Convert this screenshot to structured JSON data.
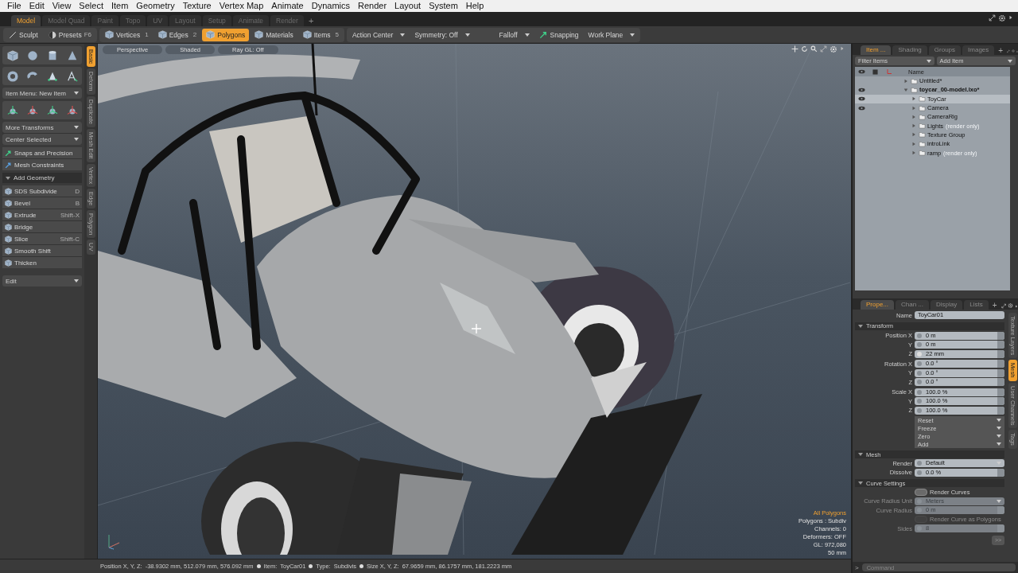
{
  "menu": [
    "File",
    "Edit",
    "View",
    "Select",
    "Item",
    "Geometry",
    "Texture",
    "Vertex Map",
    "Animate",
    "Dynamics",
    "Render",
    "Layout",
    "System",
    "Help"
  ],
  "layout_tabs": [
    {
      "label": "Model",
      "selected": true
    },
    {
      "label": "Model Quad",
      "selected": false
    },
    {
      "label": "Paint",
      "selected": false
    },
    {
      "label": "Topo",
      "selected": false
    },
    {
      "label": "UV",
      "selected": false
    },
    {
      "label": "Layout",
      "selected": false
    },
    {
      "label": "Setup",
      "selected": false
    },
    {
      "label": "Animate",
      "selected": false
    },
    {
      "label": "Render",
      "selected": false
    }
  ],
  "layout_add": "+",
  "toolbar": {
    "left": [
      {
        "label": "Sculpt"
      },
      {
        "label": "Presets",
        "shortcut": "F6"
      }
    ],
    "modes": [
      {
        "label": "Vertices",
        "shortcut": "1",
        "selected": false
      },
      {
        "label": "Edges",
        "shortcut": "2",
        "selected": false
      },
      {
        "label": "Polygons",
        "selected": true
      },
      {
        "label": "Materials",
        "selected": false
      },
      {
        "label": "Items",
        "shortcut": "5",
        "selected": false
      }
    ],
    "controls": [
      {
        "label": "Action Center",
        "kind": "dropdown"
      },
      {
        "label": "Symmetry: Off",
        "kind": "dropdown"
      },
      {
        "label": "Falloff",
        "kind": "dropdown"
      },
      {
        "label": "Snapping",
        "kind": "toggle"
      },
      {
        "label": "Work Plane",
        "kind": "dropdown"
      }
    ]
  },
  "toolbox": {
    "item_menu": "Item Menu: New Item",
    "transform_menus": [
      "More Transforms",
      "Center Selected"
    ],
    "helpers": [
      "Snaps and Precision",
      "Mesh Constraints"
    ],
    "section": {
      "label": "Add Geometry",
      "expanded": true
    },
    "tools": [
      {
        "label": "SDS Subdivide",
        "shortcut": "D"
      },
      {
        "label": "Bevel",
        "shortcut": "B"
      },
      {
        "label": "Extrude",
        "shortcut": "Shift-X"
      },
      {
        "label": "Bridge"
      },
      {
        "label": "Slice",
        "shortcut": "Shift-C"
      },
      {
        "label": "Smooth Shift"
      },
      {
        "label": "Thicken"
      }
    ],
    "edit_menu": "Edit"
  },
  "side_tabs": [
    {
      "label": "Basic",
      "selected": true
    },
    {
      "label": "Deform",
      "selected": false
    },
    {
      "label": "Duplicate",
      "selected": false
    },
    {
      "label": "Mesh Edit",
      "selected": false
    },
    {
      "label": "Vertex",
      "selected": false
    },
    {
      "label": "Edge",
      "selected": false
    },
    {
      "label": "Polygon",
      "selected": false
    },
    {
      "label": "UV",
      "selected": false
    }
  ],
  "viewport": {
    "header": [
      "Perspective",
      "Shaded",
      "Ray GL: Off"
    ],
    "info": [
      {
        "text": "All Polygons",
        "highlight": true
      },
      {
        "text": "Polygons : Subdiv",
        "highlight": false
      },
      {
        "text": "Channels: 0",
        "highlight": false
      },
      {
        "text": "Deformers: OFF",
        "highlight": false
      },
      {
        "text": "GL: 972,080",
        "highlight": false
      },
      {
        "text": "50 mm",
        "highlight": false
      }
    ]
  },
  "status_bar": [
    {
      "label": "Position X, Y, Z:",
      "value": "-38.9302 mm, 512.079 mm, 576.092 mm"
    },
    {
      "label": "Item:",
      "value": "ToyCar01"
    },
    {
      "label": "Type:",
      "value": "Subdivis"
    },
    {
      "label": "Size X, Y, Z:",
      "value": "67.9659 mm, 86.1757 mm, 181.2223 mm"
    }
  ],
  "item_panel": {
    "tabs": [
      {
        "label": "Item ...",
        "selected": true
      },
      {
        "label": "Shading",
        "selected": false
      },
      {
        "label": "Groups",
        "selected": false
      },
      {
        "label": "Images",
        "selected": false
      }
    ],
    "filter": "Filter Items",
    "add": "Add Item",
    "name_column": "Name",
    "tree": [
      {
        "name": "Untitled*",
        "bold": false,
        "visible": false,
        "selected": false,
        "expanded": false
      },
      {
        "name": "toycar_00-model.lxo*",
        "bold": true,
        "visible": true,
        "selected": false,
        "expanded": true,
        "children": [
          {
            "name": "ToyCar",
            "bold": false,
            "visible": true,
            "selected": true,
            "expanded": false
          },
          {
            "name": "Camera",
            "bold": false,
            "visible": true,
            "selected": false,
            "expanded": false
          },
          {
            "name": "CameraRig",
            "bold": false,
            "visible": false,
            "selected": false,
            "expanded": false
          },
          {
            "name": "Lights",
            "bold": false,
            "note": "(render only)",
            "visible": false,
            "selected": false,
            "expanded": false
          },
          {
            "name": "Texture Group",
            "bold": false,
            "visible": false,
            "selected": false,
            "expanded": false
          },
          {
            "name": "introLink",
            "bold": false,
            "visible": false,
            "selected": false,
            "expanded": false
          },
          {
            "name": "ramp",
            "bold": false,
            "note": "(render only)",
            "visible": false,
            "selected": false,
            "expanded": false
          }
        ]
      }
    ]
  },
  "properties": {
    "tabs": [
      {
        "label": "Prope...",
        "selected": true
      },
      {
        "label": "Chan ...",
        "selected": false
      },
      {
        "label": "Display",
        "selected": false
      },
      {
        "label": "Lists",
        "selected": false
      }
    ],
    "name_label": "Name",
    "name_value": "ToyCar01",
    "sections": [
      {
        "title": "Transform",
        "groups": [
          {
            "rows": [
              {
                "label": "Position X",
                "value": "0 m",
                "keyed": false
              },
              {
                "label": "Y",
                "value": "0 m",
                "keyed": false
              },
              {
                "label": "Z",
                "value": "22 mm",
                "keyed": true
              }
            ]
          },
          {
            "rows": [
              {
                "label": "Rotation X",
                "value": "0.0 °",
                "keyed": false
              },
              {
                "label": "Y",
                "value": "0.0 °",
                "keyed": false
              },
              {
                "label": "Z",
                "value": "0.0 °",
                "keyed": false
              }
            ]
          },
          {
            "rows": [
              {
                "label": "Scale X",
                "value": "100.0 %",
                "keyed": false
              },
              {
                "label": "Y",
                "value": "100.0 %",
                "keyed": false
              },
              {
                "label": "Z",
                "value": "100.0 %",
                "keyed": false
              }
            ]
          }
        ],
        "actions": [
          "Reset",
          "Freeze",
          "Zero",
          "Add"
        ]
      },
      {
        "title": "Mesh",
        "fields": [
          {
            "kind": "dropdown",
            "label": "Render",
            "value": "Default",
            "disabled": false
          },
          {
            "kind": "number",
            "label": "Dissolve",
            "value": "0.0 %",
            "disabled": false
          }
        ]
      },
      {
        "title": "Curve Settings",
        "fields": [
          {
            "kind": "checkbox",
            "value": "Render Curves",
            "disabled": false
          },
          {
            "kind": "dropdown",
            "label": "Curve Radius Unit",
            "value": "Meters",
            "disabled": true
          },
          {
            "kind": "number",
            "label": "Curve Radius",
            "value": "0 m",
            "disabled": true
          },
          {
            "kind": "checkbox",
            "value": "Render Curve as Polygons",
            "disabled": true
          },
          {
            "kind": "number",
            "label": "Sides",
            "value": "8",
            "disabled": true
          }
        ]
      }
    ],
    "more": ">>",
    "side_tabs": [
      {
        "label": "Texture Layers",
        "selected": false
      },
      {
        "label": "Mesh",
        "selected": true
      },
      {
        "label": "User Channels",
        "selected": false
      },
      {
        "label": "Tags",
        "selected": false
      }
    ]
  },
  "command": {
    "prompt": ">",
    "placeholder": "Command"
  }
}
